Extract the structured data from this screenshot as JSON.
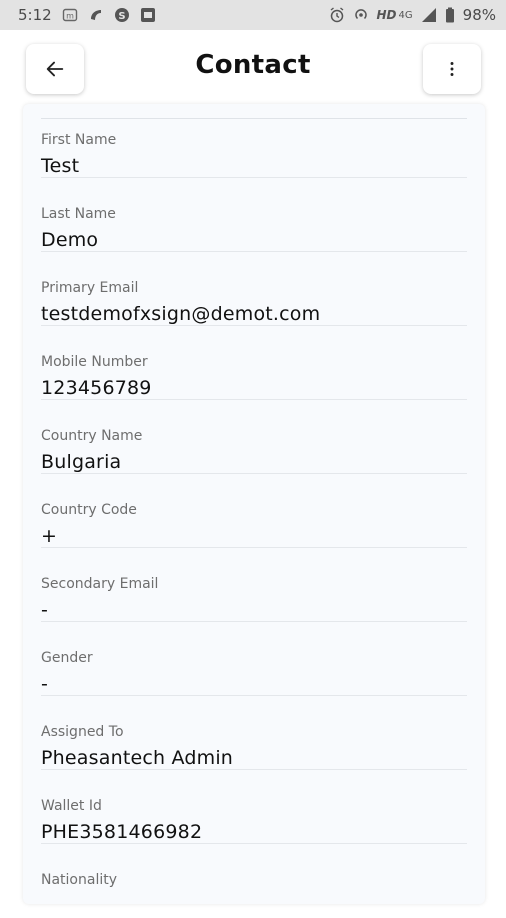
{
  "status_bar": {
    "time": "5:12",
    "network_label": "HD",
    "network_type": "4G",
    "battery": "98%",
    "icons": [
      "notification-m-icon",
      "vpn-icon",
      "skype-icon",
      "app-icon",
      "alarm-icon",
      "hotspot-icon",
      "signal-icon",
      "battery-icon"
    ]
  },
  "header": {
    "title": "Contact",
    "back_icon": "arrow-left-icon",
    "more_icon": "more-vertical-icon"
  },
  "fields": [
    {
      "label": "First Name",
      "value": "Test"
    },
    {
      "label": "Last Name",
      "value": "Demo"
    },
    {
      "label": "Primary Email",
      "value": "testdemofxsign@demot.com"
    },
    {
      "label": "Mobile Number",
      "value": "123456789"
    },
    {
      "label": "Country Name",
      "value": "Bulgaria"
    },
    {
      "label": "Country Code",
      "value": "+"
    },
    {
      "label": "Secondary Email",
      "value": "-"
    },
    {
      "label": "Gender",
      "value": "-"
    },
    {
      "label": "Assigned To",
      "value": "Pheasantech Admin"
    },
    {
      "label": "Wallet Id",
      "value": "PHE3581466982"
    },
    {
      "label": "Nationality",
      "value": ""
    }
  ],
  "colors": {
    "status_bar_bg": "#e3e3e3",
    "card_bg": "#f8fafd",
    "label": "#6e6e6e",
    "value": "#111111"
  }
}
